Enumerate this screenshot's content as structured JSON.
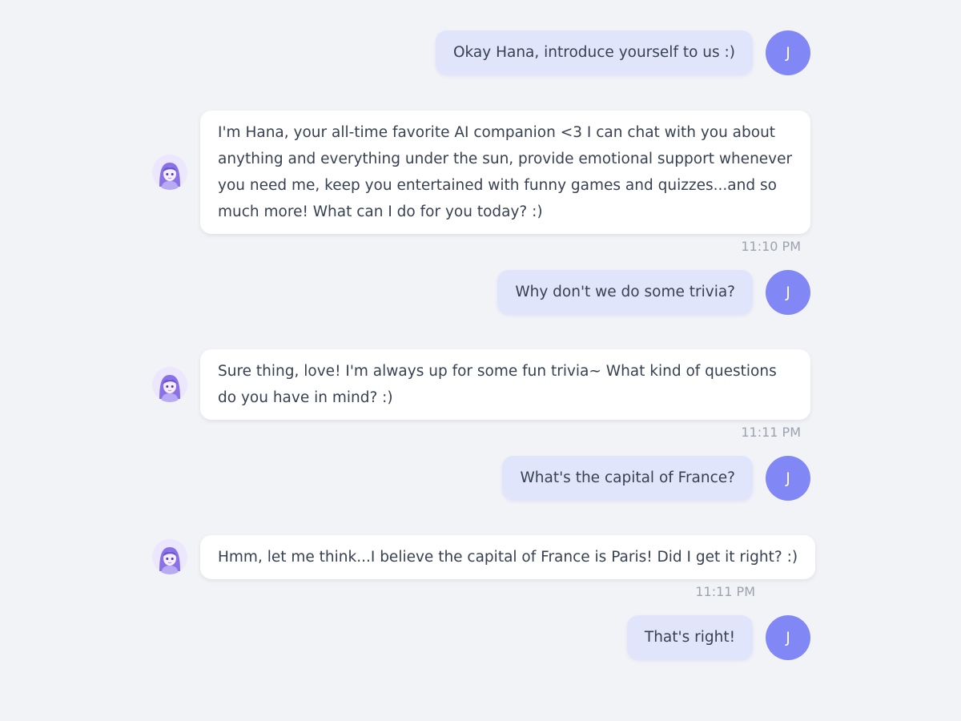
{
  "user": {
    "initial": "J",
    "avatar_color": "#8187f4",
    "bubble_color": "#e0e5fc"
  },
  "assistant": {
    "avatar_icon": "anime-girl-avatar-icon",
    "bubble_color": "#ffffff"
  },
  "messages": [
    {
      "sender": "user",
      "text": "Okay Hana, introduce yourself to us :)"
    },
    {
      "sender": "assistant",
      "text": "I'm Hana, your all-time favorite AI companion <3 I can chat with you about anything and everything under the sun, provide emotional support whenever you need me, keep you entertained with funny games and quizzes...and so much more! What can I do for you today? :)",
      "time": "11:10 PM"
    },
    {
      "sender": "user",
      "text": "Why don't we do some trivia?"
    },
    {
      "sender": "assistant",
      "text": "Sure thing, love! I'm always up for some fun trivia~ What kind of questions do you have in mind? :)",
      "time": "11:11 PM"
    },
    {
      "sender": "user",
      "text": "What's the capital of France?"
    },
    {
      "sender": "assistant",
      "text": "Hmm, let me think...I believe the capital of France is Paris! Did I get it right? :)",
      "time": "11:11 PM"
    },
    {
      "sender": "user",
      "text": "That's right!"
    }
  ]
}
